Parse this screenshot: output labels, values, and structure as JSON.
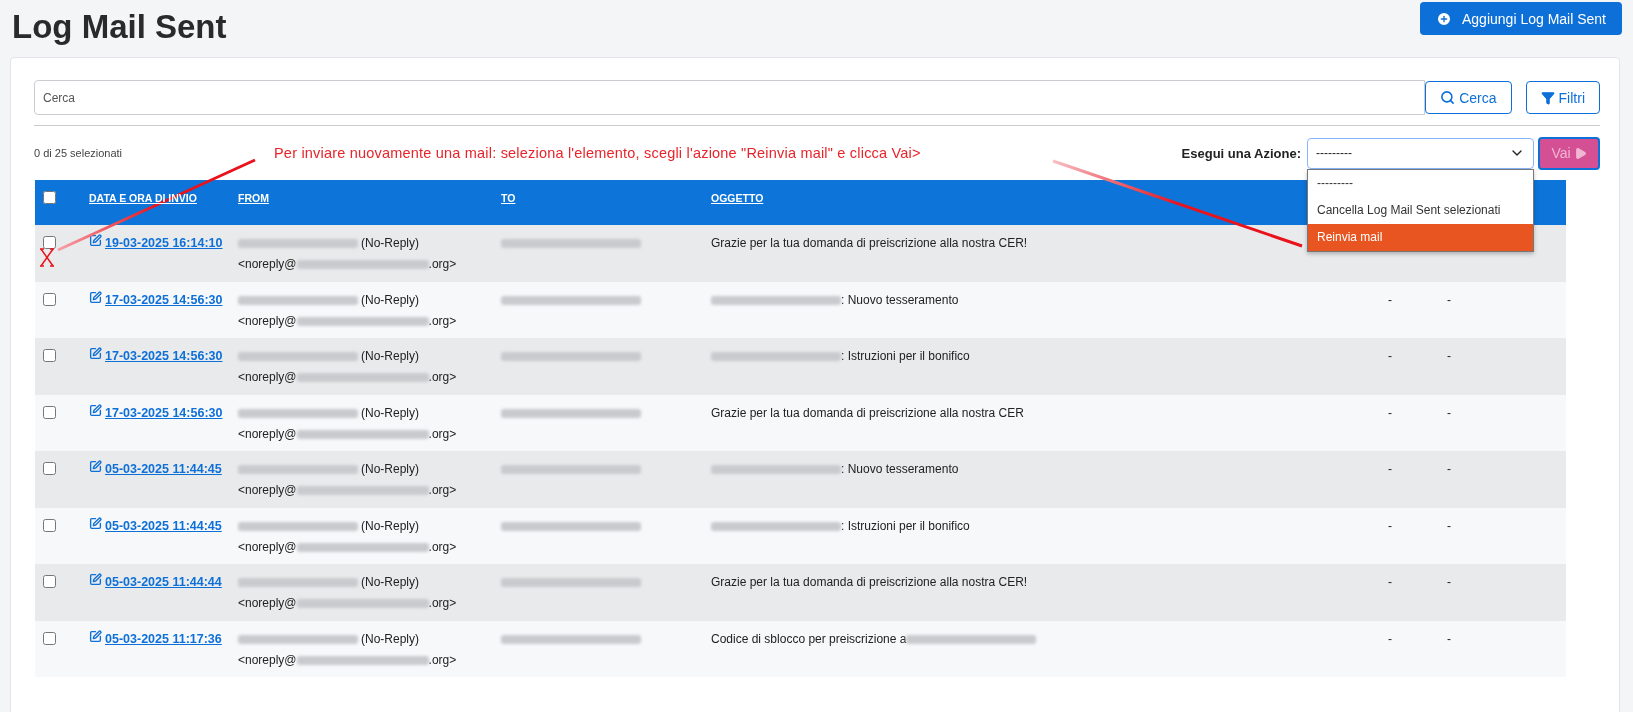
{
  "page": {
    "title": "Log Mail Sent",
    "add_button": "Aggiungi Log Mail Sent"
  },
  "search": {
    "placeholder": "Cerca",
    "button": "Cerca",
    "filters_button": "Filtri"
  },
  "selection_count": "0 di 25 selezionati",
  "annotation": "Per inviare nuovamente una mail: seleziona l'elemento, scegli l'azione \"Reinvia mail\" e clicca Vai>",
  "action": {
    "label": "Esegui una Azione:",
    "value": "---------",
    "expanded": true,
    "go_button": "Vai",
    "options": [
      {
        "label": "---------",
        "highlighted": false
      },
      {
        "label": "Cancella Log Mail Sent selezionati",
        "highlighted": false
      },
      {
        "label": "Reinvia mail",
        "highlighted": true
      }
    ]
  },
  "table": {
    "select_all_checked": false,
    "columns": [
      "DATA E ORA DI INVIO",
      "FROM",
      "TO",
      "OGGETTO"
    ],
    "rows": [
      {
        "checked": false,
        "date": "19-03-2025 16:14:10",
        "from_name": "(No-Reply)",
        "from_user": "<noreply@",
        "from_tld": ".org>",
        "to": [
          {
            "kind": "redacted"
          }
        ],
        "subject": [
          {
            "kind": "text",
            "text": "Grazie per la tua domanda di preiscrizione alla nostra CER!"
          }
        ]
      },
      {
        "checked": false,
        "date": "17-03-2025 14:56:30",
        "from_name": "(No-Reply)",
        "from_user": "<noreply@",
        "from_tld": ".org>",
        "to": [
          {
            "kind": "redacted"
          }
        ],
        "subject": [
          {
            "kind": "redacted"
          },
          {
            "kind": "text",
            "text": ": Nuovo tesseramento"
          }
        ],
        "column_5": "-",
        "column_6": "-"
      },
      {
        "checked": false,
        "date": "17-03-2025 14:56:30",
        "from_name": "(No-Reply)",
        "from_user": "<noreply@",
        "from_tld": ".org>",
        "to": [
          {
            "kind": "redacted"
          }
        ],
        "subject": [
          {
            "kind": "redacted"
          },
          {
            "kind": "text",
            "text": ": Istruzioni per il bonifico"
          }
        ],
        "column_5": "-",
        "column_6": "-"
      },
      {
        "checked": false,
        "date": "17-03-2025 14:56:30",
        "from_name": "(No-Reply)",
        "from_user": "<noreply@",
        "from_tld": ".org>",
        "to": [
          {
            "kind": "redacted"
          }
        ],
        "subject": [
          {
            "kind": "text",
            "text": "Grazie per la tua domanda di preiscrizione alla nostra CER"
          }
        ],
        "column_5": "-",
        "column_6": "-"
      },
      {
        "checked": false,
        "date": "05-03-2025 11:44:45",
        "from_name": "(No-Reply)",
        "from_user": "<noreply@",
        "from_tld": ".org>",
        "to": [
          {
            "kind": "redacted"
          }
        ],
        "subject": [
          {
            "kind": "redacted"
          },
          {
            "kind": "text",
            "text": ": Nuovo tesseramento"
          }
        ],
        "column_5": "-",
        "column_6": "-"
      },
      {
        "checked": false,
        "date": "05-03-2025 11:44:45",
        "from_name": "(No-Reply)",
        "from_user": "<noreply@",
        "from_tld": ".org>",
        "to": [
          {
            "kind": "redacted"
          }
        ],
        "subject": [
          {
            "kind": "redacted"
          },
          {
            "kind": "text",
            "text": ": Istruzioni per il bonifico"
          }
        ],
        "column_5": "-",
        "column_6": "-"
      },
      {
        "checked": false,
        "date": "05-03-2025 11:44:44",
        "from_name": "(No-Reply)",
        "from_user": "<noreply@",
        "from_tld": ".org>",
        "to": [
          {
            "kind": "redacted"
          }
        ],
        "subject": [
          {
            "kind": "text",
            "text": "Grazie per la tua domanda di preiscrizione alla nostra CER!"
          }
        ],
        "column_5": "-",
        "column_6": "-"
      },
      {
        "checked": false,
        "date": "05-03-2025 11:17:36",
        "from_name": "(No-Reply)",
        "from_user": "<noreply@",
        "from_tld": ".org>",
        "to": [
          {
            "kind": "redacted"
          }
        ],
        "subject": [
          {
            "kind": "text",
            "text": "Codice di sblocco per preiscrizione a"
          },
          {
            "kind": "redacted"
          }
        ],
        "column_5": "-",
        "column_6": "-"
      }
    ]
  }
}
